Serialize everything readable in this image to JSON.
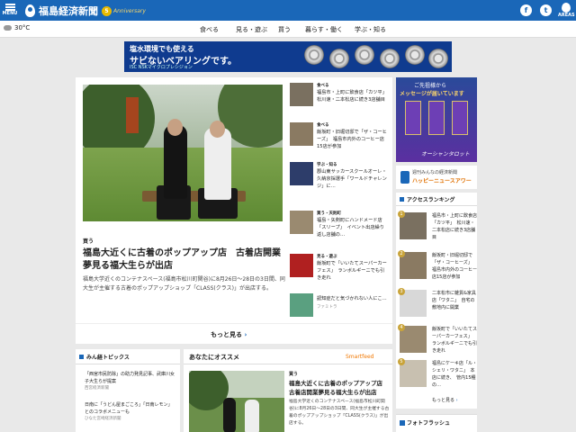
{
  "header": {
    "menu_label": "MENU",
    "site_name": "福島経済新聞",
    "anniversary_num": "5",
    "anniversary_text": "Anniversary",
    "areas_label": "AREAS",
    "bg_color": "#1a67b8"
  },
  "weather": {
    "temp": "30°C"
  },
  "nav": {
    "items": [
      "食べる",
      "見る・遊ぶ",
      "買う",
      "暮らす・働く",
      "学ぶ・知る"
    ]
  },
  "top_ad": {
    "line1": "塩水環境でも使える",
    "line2": "サビないベアリングです。",
    "brand": "ISC NSKマイクロプレシジョン"
  },
  "hero": {
    "category": "買う",
    "title": "福島大近くに古着のポップアップ店　古着店開業夢見る福大生らが出店",
    "description": "福島大学近くのコンテナスペース(福島市松川町関谷)に8月26日～28日の3日間、同大生が主催する古着のポップアップショップ「CLASS(クラス)」が出店する。",
    "more_label": "もっと見る"
  },
  "side_articles": [
    {
      "category": "食べる",
      "title": "福島市・上町に飲食店「カツ平」　松川速・二本松店に続き3店舗目",
      "sub": ""
    },
    {
      "category": "食べる",
      "title": "飯坂町・旧堀切邸で「ザ・コーヒーズ」　福島市内外のコーヒー店15店が参加",
      "sub": ""
    },
    {
      "category": "学ぶ・知る",
      "title": "郡山東サッカースクールオーレ・久納京採選手「ワールドチャレンジ」に…",
      "sub": ""
    },
    {
      "category": "買う・天則町",
      "title": "福島・矢剣町にハンドメード店「スリープ」　イベント出店繰り返し店舗の…",
      "sub": ""
    },
    {
      "category": "見る・遊ぶ",
      "title": "飯坂町で「いいたてスーパーカーフェス」　ランボルギーニでも引き走れ",
      "sub": ""
    },
    {
      "category": "",
      "title": "認知症だと気づかれない人にこ…",
      "sub": "ファミトラ"
    }
  ],
  "right_ad": {
    "line1": "ご先祖様から",
    "line2": "メッセージが届いています",
    "line3": "オーシャンタロット"
  },
  "happy_banner": {
    "line1": "週刊みんなの経済新聞",
    "line2": "ハッピーニュースアワー"
  },
  "ranking": {
    "heading": "アクセスランキング",
    "items": [
      {
        "num": "1",
        "title": "福島市・上町に飲食店「カツ平」　松川速・二本松店に続き3店舗目"
      },
      {
        "num": "2",
        "title": "飯坂町・旧堀切邸で「ザ・コーヒーズ」　福島市内外のコーヒー店15店が参加"
      },
      {
        "num": "3",
        "title": "二本松市に雑貨&家具店「ワタニ」　自宅の敷地内に開業"
      },
      {
        "num": "4",
        "title": "飯坂町で「いいたてスーパーカーフェス」　ランボルギーニでも引き走れ"
      },
      {
        "num": "5",
        "title": "福島にケーキ店「ル・シェリ・ワタニ」　本店に続き、　管内15種の…"
      }
    ],
    "more_label": "もっと見る"
  },
  "flash": {
    "heading": "フォトフラッシュ"
  },
  "topics": {
    "heading": "みん経トピックス",
    "items": [
      {
        "title": "「西宮市民防除」の助力発見記事、武庫川女子大生らが提案",
        "source": "西宮経済新聞"
      },
      {
        "title": "日南に「うどん屋まごころ」「日南レモン」とのコラボメニューも",
        "source": "ひなた宮崎経済新聞"
      }
    ]
  },
  "recommend": {
    "heading": "あなたにオススメ",
    "provider": "Smartfeed",
    "category": "買う",
    "title": "福島大近くに古着のポップアップ店　古着店開業夢見る福大生らが出店",
    "description": "福島大学近くのコンテナスペース(福島市松川町関谷)に8月26日～28日の3日間、同大生が主催する古着のポップアップショップ「CLASS(クラス)」が出店する。"
  }
}
